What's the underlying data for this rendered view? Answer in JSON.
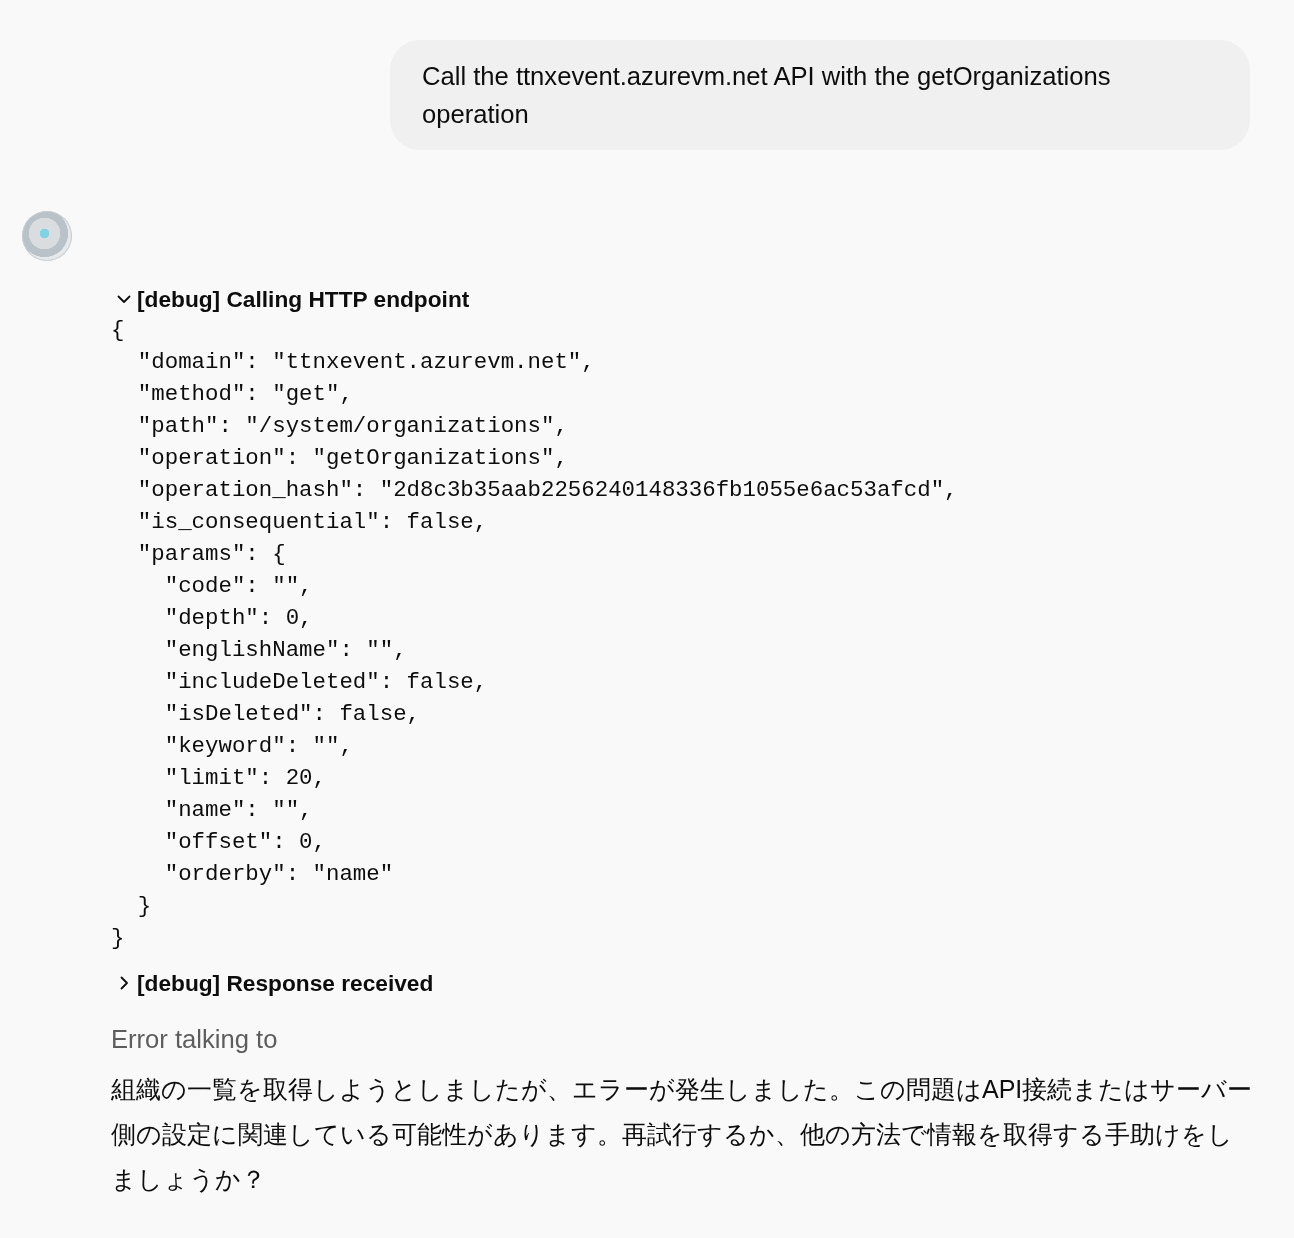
{
  "user_message": {
    "text": "Call the ttnxevent.azurevm.net API with the getOrganizations operation"
  },
  "assistant": {
    "debug_sections": [
      {
        "title": "[debug] Calling HTTP endpoint",
        "expanded": true,
        "body": "{\n  \"domain\": \"ttnxevent.azurevm.net\",\n  \"method\": \"get\",\n  \"path\": \"/system/organizations\",\n  \"operation\": \"getOrganizations\",\n  \"operation_hash\": \"2d8c3b35aab2256240148336fb1055e6ac53afcd\",\n  \"is_consequential\": false,\n  \"params\": {\n    \"code\": \"\",\n    \"depth\": 0,\n    \"englishName\": \"\",\n    \"includeDeleted\": false,\n    \"isDeleted\": false,\n    \"keyword\": \"\",\n    \"limit\": 20,\n    \"name\": \"\",\n    \"offset\": 0,\n    \"orderby\": \"name\"\n  }\n}"
      },
      {
        "title": "[debug] Response received",
        "expanded": false
      }
    ],
    "status": "Error talking to",
    "reply": "組織の一覧を取得しようとしましたが、エラーが発生しました。この問題はAPI接続またはサーバー側の設定に関連している可能性があります。再試行するか、他の方法で情報を取得する手助けをしましょうか？"
  }
}
